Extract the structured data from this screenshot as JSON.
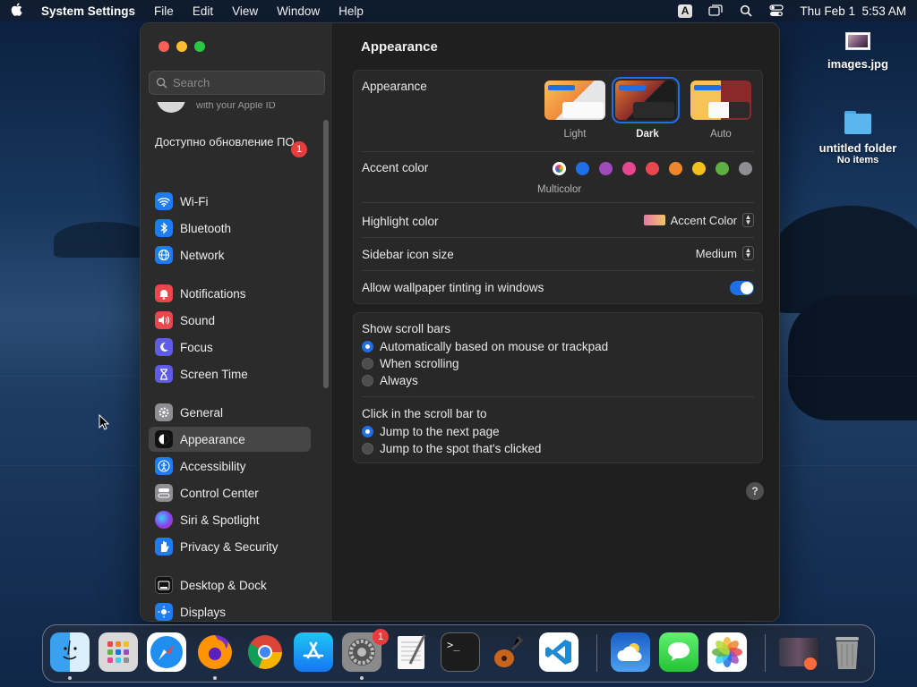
{
  "menubar": {
    "app_name": "System Settings",
    "menus": [
      "File",
      "Edit",
      "View",
      "Window",
      "Help"
    ],
    "input_badge": "A",
    "datetime": "Thu Feb 1  5:53 AM"
  },
  "desktop": {
    "items": [
      {
        "label": "images.jpg",
        "sub": ""
      },
      {
        "label": "untitled folder",
        "sub": "No items"
      }
    ]
  },
  "sidebar": {
    "search_placeholder": "Search",
    "apple_id_fragment": "with your Apple ID",
    "update": {
      "label": "Доступно обновление ПО",
      "badge": "1"
    },
    "items": [
      {
        "label": "Wi-Fi",
        "icon": "wifi-icon",
        "color": "#1d7cf2"
      },
      {
        "label": "Bluetooth",
        "icon": "bluetooth-icon",
        "color": "#1d7cf2"
      },
      {
        "label": "Network",
        "icon": "globe-icon",
        "color": "#1d7cf2"
      },
      {
        "label": "Notifications",
        "icon": "bell-icon",
        "color": "#e8474d"
      },
      {
        "label": "Sound",
        "icon": "speaker-icon",
        "color": "#e8474d"
      },
      {
        "label": "Focus",
        "icon": "moon-icon",
        "color": "#5e5ce6"
      },
      {
        "label": "Screen Time",
        "icon": "hourglass-icon",
        "color": "#5e5ce6"
      },
      {
        "label": "General",
        "icon": "gear-icon",
        "color": "#8e8e93"
      },
      {
        "label": "Appearance",
        "icon": "appearance-icon",
        "color": "#1a1a1a"
      },
      {
        "label": "Accessibility",
        "icon": "accessibility-icon",
        "color": "#1d7cf2"
      },
      {
        "label": "Control Center",
        "icon": "control-center-icon",
        "color": "#8e8e93"
      },
      {
        "label": "Siri & Spotlight",
        "icon": "siri-icon",
        "color": "#8a3ff0"
      },
      {
        "label": "Privacy & Security",
        "icon": "hand-icon",
        "color": "#1d7cf2"
      },
      {
        "label": "Desktop & Dock",
        "icon": "dock-icon",
        "color": "#1a1a1a"
      },
      {
        "label": "Displays",
        "icon": "sun-icon",
        "color": "#1d7cf2"
      }
    ],
    "selected": "Appearance"
  },
  "main": {
    "title": "Appearance",
    "appearance": {
      "label": "Appearance",
      "options": [
        "Light",
        "Dark",
        "Auto"
      ],
      "selected": "Dark"
    },
    "accent": {
      "label": "Accent color",
      "colors": [
        "multicolor",
        "#1f6fe6",
        "#a04bbb",
        "#e6478f",
        "#e8474d",
        "#f0862a",
        "#f2c01a",
        "#5eb043",
        "#8e8e93"
      ],
      "selected_caption": "Multicolor"
    },
    "highlight": {
      "label": "Highlight color",
      "value": "Accent Color"
    },
    "sidebar_icon_size": {
      "label": "Sidebar icon size",
      "value": "Medium"
    },
    "wallpaper_tinting": {
      "label": "Allow wallpaper tinting in windows",
      "enabled": true
    },
    "scroll_bars": {
      "label": "Show scroll bars",
      "options": [
        "Automatically based on mouse or trackpad",
        "When scrolling",
        "Always"
      ],
      "selected": 0
    },
    "click_scroll": {
      "label": "Click in the scroll bar to",
      "options": [
        "Jump to the next page",
        "Jump to the spot that's clicked"
      ],
      "selected": 0
    },
    "help": "?"
  },
  "dock": {
    "apps": [
      "Finder",
      "Launchpad",
      "Safari",
      "Firefox",
      "Chrome",
      "App Store",
      "System Settings",
      "TextEdit",
      "Terminal",
      "GarageBand",
      "Visual Studio Code",
      "Weather",
      "Messages",
      "Photos",
      "Downloads",
      "Trash"
    ],
    "system_settings_badge": "1"
  }
}
